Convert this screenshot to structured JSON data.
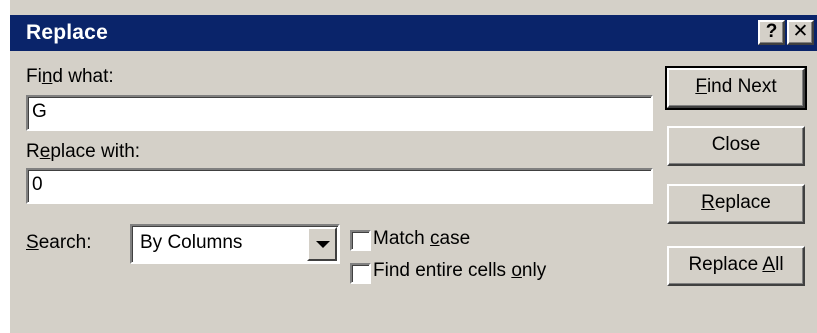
{
  "window": {
    "title": "Replace",
    "help_glyph": "?",
    "close_glyph": "✕"
  },
  "find": {
    "label_pre": "Fi",
    "label_key": "n",
    "label_post": "d what:",
    "value": "G"
  },
  "replace": {
    "label_pre": "R",
    "label_key": "e",
    "label_post": "place with:",
    "value": "0"
  },
  "search": {
    "label_pre": "",
    "label_key": "S",
    "label_post": "earch:",
    "selected": "By Columns"
  },
  "options": {
    "match_case": {
      "label_pre": "Match ",
      "label_key": "c",
      "label_post": "ase",
      "checked": false
    },
    "entire_cells": {
      "label_pre": "Find entire cells ",
      "label_key": "o",
      "label_post": "nly",
      "checked": false
    }
  },
  "buttons": {
    "find_next": {
      "pre": "",
      "key": "F",
      "post": "ind Next"
    },
    "close": {
      "label": "Close"
    },
    "replace": {
      "pre": "",
      "key": "R",
      "post": "eplace"
    },
    "replace_all": {
      "pre": "Replace ",
      "key": "A",
      "post": "ll"
    }
  },
  "colors": {
    "titlebar": "#0a246a",
    "face": "#d4d0c8"
  }
}
